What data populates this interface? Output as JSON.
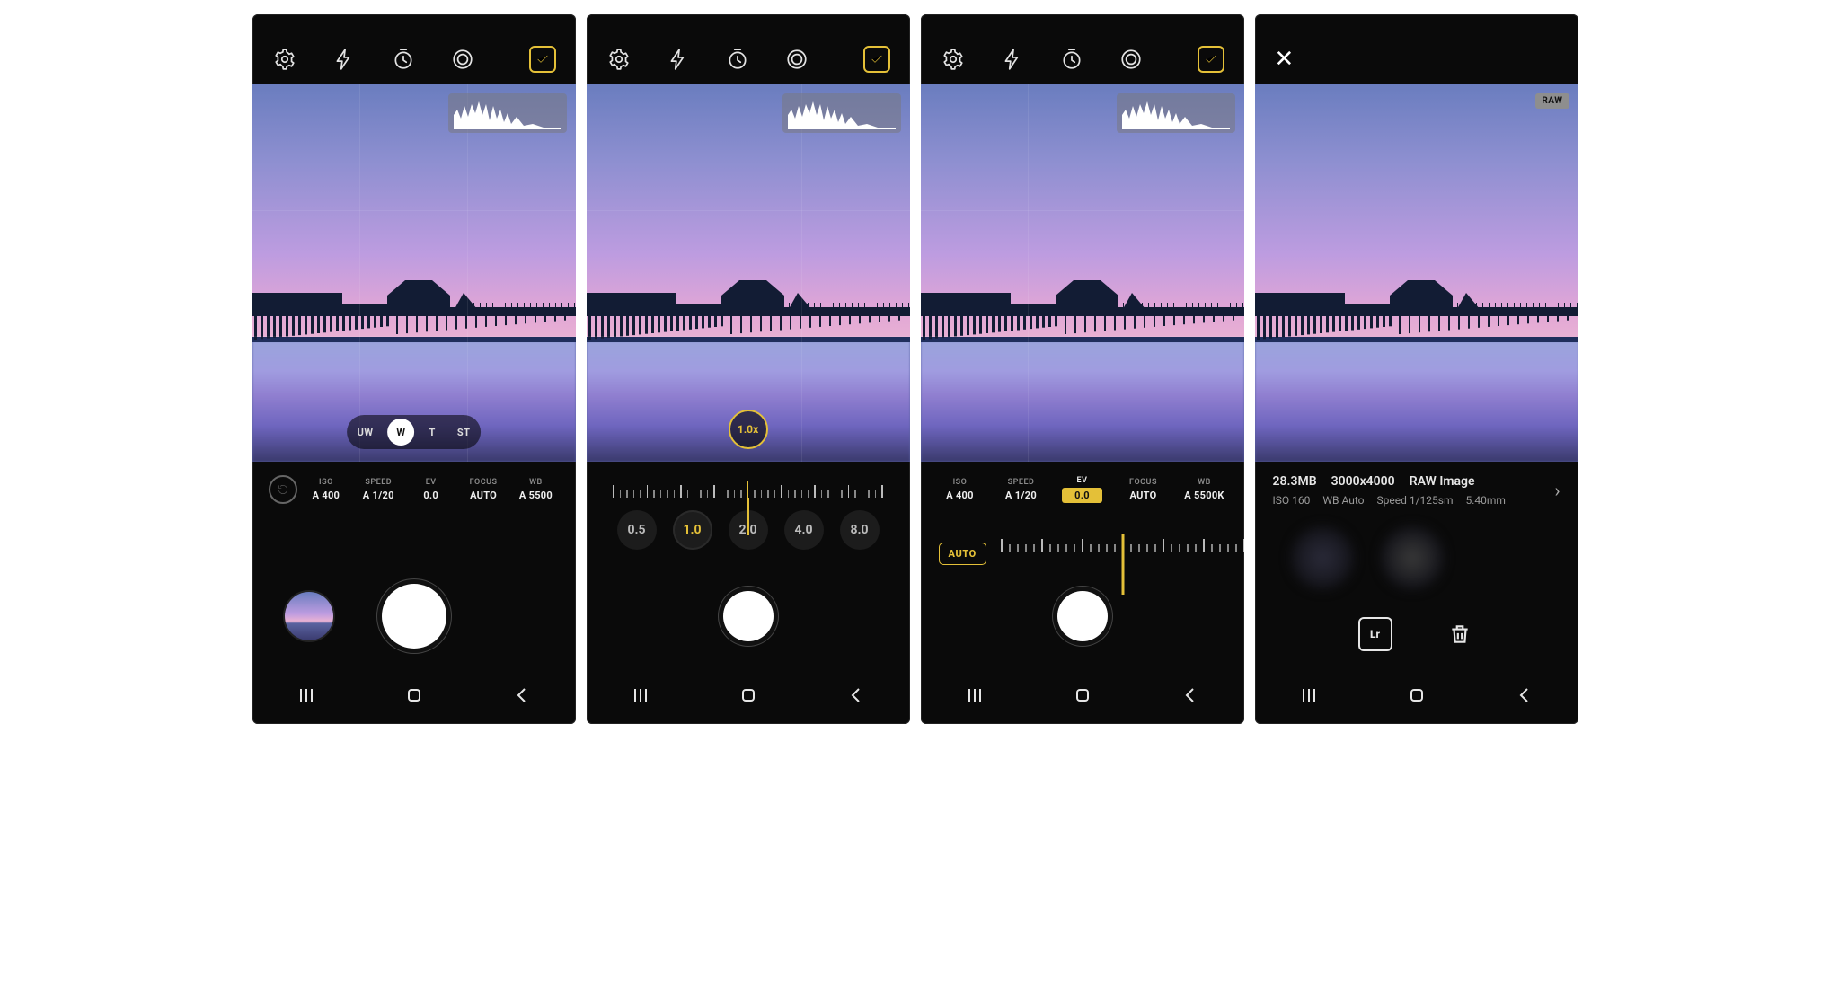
{
  "accent_color": "#e4c038",
  "screens": [
    {
      "id": "s1",
      "type": "camera-main",
      "toolbar_icons": [
        "settings",
        "flash",
        "timer",
        "metering",
        "histogram-toggle"
      ],
      "histogram_visible": true,
      "lens_options": [
        "UW",
        "W",
        "T",
        "ST"
      ],
      "lens_active": "W",
      "params": {
        "iso": {
          "label": "ISO",
          "value": "A 400"
        },
        "speed": {
          "label": "SPEED",
          "value": "A 1/20"
        },
        "ev": {
          "label": "EV",
          "value": "0.0"
        },
        "focus": {
          "label": "FOCUS",
          "value": "AUTO"
        },
        "wb": {
          "label": "WB",
          "value": "A 5500"
        }
      },
      "reset_visible": true,
      "shutter_size": "large",
      "gallery_thumb": true
    },
    {
      "id": "s2",
      "type": "camera-zoom",
      "toolbar_icons": [
        "settings",
        "flash",
        "timer",
        "metering",
        "histogram-toggle"
      ],
      "histogram_visible": true,
      "zoom_indicator": "1.0x",
      "zoom_stops": [
        "0.5",
        "1.0",
        "2.0",
        "4.0",
        "8.0"
      ],
      "zoom_active": "1.0",
      "shutter_size": "small"
    },
    {
      "id": "s3",
      "type": "camera-ev",
      "toolbar_icons": [
        "settings",
        "flash",
        "timer",
        "metering",
        "histogram-toggle"
      ],
      "histogram_visible": true,
      "params": {
        "iso": {
          "label": "ISO",
          "value": "A 400"
        },
        "speed": {
          "label": "SPEED",
          "value": "A 1/20"
        },
        "ev": {
          "label": "EV",
          "value": "0.0",
          "active": true
        },
        "focus": {
          "label": "FOCUS",
          "value": "AUTO"
        },
        "wb": {
          "label": "WB",
          "value": "A 5500K"
        }
      },
      "auto_chip": "AUTO",
      "shutter_size": "small"
    },
    {
      "id": "s4",
      "type": "review",
      "raw_badge": "RAW",
      "info_line1": {
        "filesize": "28.3MB",
        "resolution": "3000x4000",
        "format": "RAW Image"
      },
      "info_line2": {
        "iso": "ISO 160",
        "wb": "WB Auto",
        "speed": "Speed 1/125sm",
        "focal": "5.40mm"
      },
      "actions": {
        "lr": "Lr",
        "trash": "trash-icon"
      }
    }
  ]
}
